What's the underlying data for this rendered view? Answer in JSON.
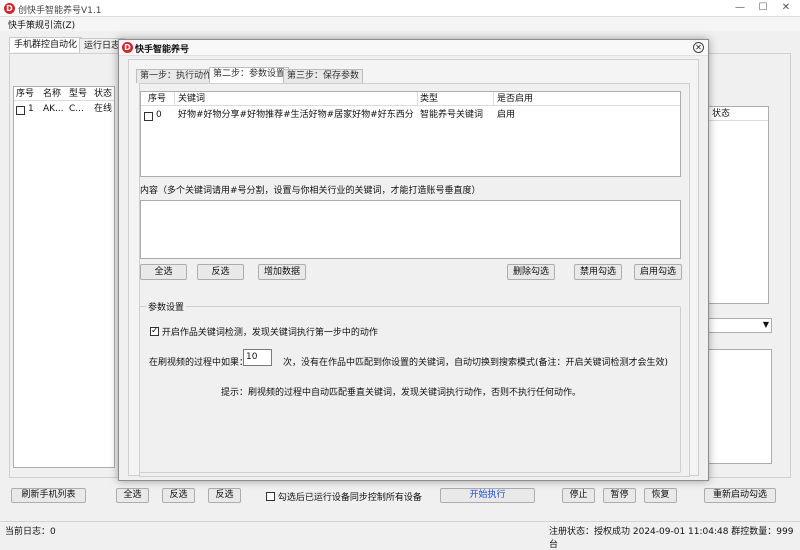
{
  "window": {
    "title": "创快手智能养号V1.1",
    "minimize": "—",
    "maximize": "☐",
    "close": "✕"
  },
  "menu": {
    "item": "快手策规引流(Z)"
  },
  "main_tabs": [
    "手机群控自动化",
    "运行日志"
  ],
  "device_list": {
    "headers": [
      "序号",
      "名称",
      "型号",
      "状态"
    ],
    "rows": [
      {
        "no": "1",
        "name": "AK...",
        "model": "C...",
        "status": "在线"
      }
    ]
  },
  "right_list": {
    "header": "状态"
  },
  "bottom_buttons": {
    "refresh": "刷新手机列表",
    "select_all": "全选",
    "invert": "反选",
    "start": "开始执行",
    "stop": "停止",
    "pause": "暂停",
    "resume": "恢复",
    "restart": "重新启动勾选",
    "checkbox_label": "勾选后已运行设备同步控制所有设备"
  },
  "statusbar": {
    "log_label": "当前日志：0",
    "license": "注册状态：授权成功 2024-09-01 11:04:48 群控数量：999台"
  },
  "dialog": {
    "title": "快手智能养号",
    "logo": "D",
    "close": "✕",
    "tabs": [
      "第一步：执行动作",
      "第二步：参数设置",
      "第三步：保存参数"
    ],
    "table": {
      "headers": [
        "序号",
        "关键词",
        "类型",
        "是否启用"
      ],
      "rows": [
        {
          "no": "0",
          "keyword": "好物#好物分享#好物推荐#生活好物#居家好物#好东西分享#...",
          "type": "智能养号关键词",
          "enabled": "启用"
        }
      ]
    },
    "content_label": "内容（多个关键词请用#号分割，设置与你相关行业的关键词，才能打造账号垂直度）",
    "content_value": "",
    "buttons": {
      "select_all": "全选",
      "invert": "反选",
      "add": "增加数据",
      "delete": "删除勾选",
      "disable": "禁用勾选",
      "enable": "启用勾选"
    },
    "params": {
      "legend": "参数设置",
      "enable_check_label": "开启作品关键词检测，发现关键词执行第一步中的动作",
      "enable_checked": true,
      "prefix": "在刷视频的过程中如果：",
      "count_value": "10",
      "suffix": "次，没有在作品中匹配到你设置的关键词，自动切换到搜索模式(备注：开启关键词检测才会生效)",
      "hint": "提示：刷视频的过程中自动匹配垂直关键词，发现关键词执行动作，否则不执行任何动作。"
    }
  },
  "colors": {
    "logo_red": "#d8222a",
    "accent_blue": "#1a4fd8"
  }
}
